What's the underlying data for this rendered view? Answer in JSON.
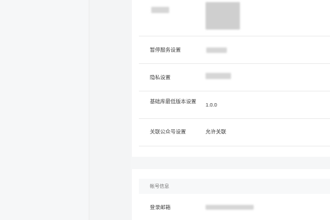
{
  "settings": {
    "rows": [
      {
        "label": "",
        "value": ""
      },
      {
        "label": "暂停服务设置",
        "value": ""
      },
      {
        "label": "隐私设置",
        "value": ""
      },
      {
        "label": "基础库最低版本设置",
        "value": "1.0.0"
      },
      {
        "label": "关联公众号设置",
        "value": "允许关联"
      }
    ]
  },
  "account": {
    "section_title": "帐号信息",
    "rows": [
      {
        "label": "登录邮箱",
        "value": ""
      }
    ]
  }
}
